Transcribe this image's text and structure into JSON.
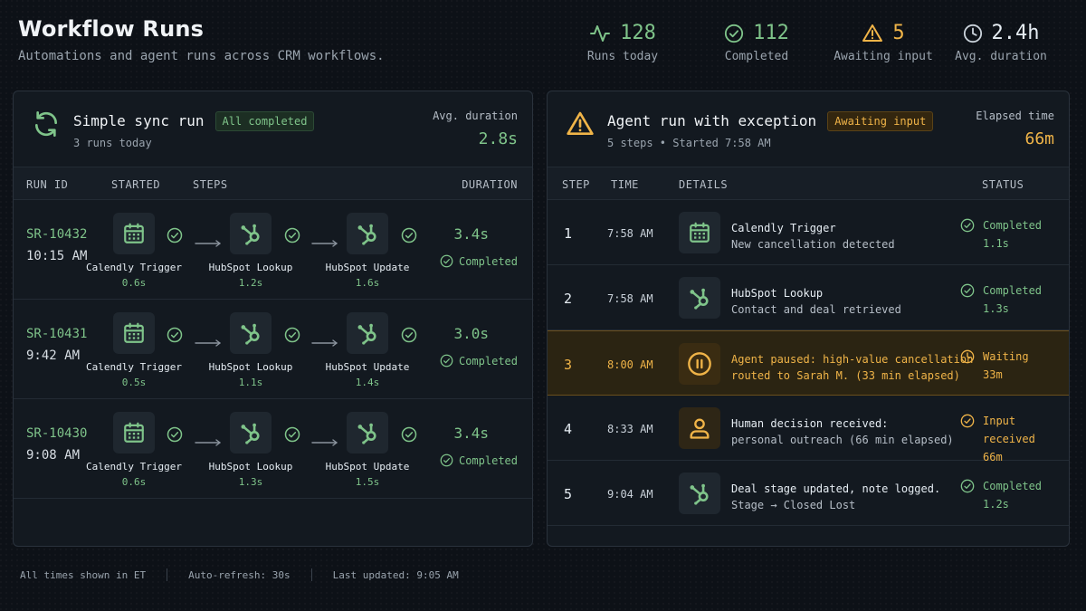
{
  "header": {
    "title": "Workflow Runs",
    "subtitle": "Automations and agent runs across CRM workflows."
  },
  "stats": [
    {
      "value": "128",
      "label": "Runs today",
      "icon": "activity-icon",
      "color": "#7fc48a"
    },
    {
      "value": "112",
      "label": "Completed",
      "icon": "check-circle-icon",
      "color": "#7fc48a"
    },
    {
      "value": "5",
      "label": "Awaiting input",
      "icon": "warning-icon",
      "color": "#f0b448"
    },
    {
      "value": "2.4h",
      "label": "Avg. duration",
      "icon": "clock-icon",
      "color": "#e6edf3"
    }
  ],
  "left_panel": {
    "title": "Simple sync run",
    "badge": "All completed",
    "subtitle": "3 runs today",
    "metric_label": "Avg. duration",
    "metric_value": "2.8s",
    "columns": [
      "RUN ID",
      "STARTED",
      "STEPS",
      "DURATION"
    ],
    "runs": [
      {
        "id": "SR-10432",
        "time": "10:15 AM",
        "duration": "3.4s",
        "status": "Completed",
        "steps": [
          {
            "name": "Calendly Trigger",
            "dur": "0.6s"
          },
          {
            "name": "HubSpot Lookup",
            "dur": "1.2s"
          },
          {
            "name": "HubSpot Update",
            "dur": "1.6s"
          }
        ]
      },
      {
        "id": "SR-10431",
        "time": "9:42 AM",
        "duration": "3.0s",
        "status": "Completed",
        "steps": [
          {
            "name": "Calendly Trigger",
            "dur": "0.5s"
          },
          {
            "name": "HubSpot Lookup",
            "dur": "1.1s"
          },
          {
            "name": "HubSpot Update",
            "dur": "1.4s"
          }
        ]
      },
      {
        "id": "SR-10430",
        "time": "9:08 AM",
        "duration": "3.4s",
        "status": "Completed",
        "steps": [
          {
            "name": "Calendly Trigger",
            "dur": "0.6s"
          },
          {
            "name": "HubSpot Lookup",
            "dur": "1.3s"
          },
          {
            "name": "HubSpot Update",
            "dur": "1.5s"
          }
        ]
      }
    ]
  },
  "right_panel": {
    "title": "Agent run with exception",
    "badge": "Awaiting input",
    "subtitle": "5 steps • Started 7:58 AM",
    "metric_label": "Elapsed time",
    "metric_value": "66m",
    "columns": [
      "STEP",
      "TIME",
      "DETAILS",
      "STATUS"
    ],
    "steps": [
      {
        "num": "1",
        "time": "7:58 AM",
        "icon": "calendar-icon",
        "d1": "Calendly Trigger",
        "d2": "New cancellation detected",
        "status": "Completed",
        "sub": "1.1s"
      },
      {
        "num": "2",
        "time": "7:58 AM",
        "icon": "hubspot-icon",
        "d1": "HubSpot Lookup",
        "d2": "Contact and deal retrieved",
        "status": "Completed",
        "sub": "1.3s"
      },
      {
        "num": "3",
        "time": "8:00 AM",
        "icon": "pause-icon",
        "d1": "Agent paused: high-value cancellation",
        "d2": "routed to Sarah M. (33 min elapsed)",
        "status": "Waiting",
        "sub": "33m"
      },
      {
        "num": "4",
        "time": "8:33 AM",
        "icon": "person-icon",
        "d1": "Human decision received:",
        "d2": "personal outreach (66 min elapsed)",
        "status": "Input received",
        "sub": "66m"
      },
      {
        "num": "5",
        "time": "9:04 AM",
        "icon": "hubspot-icon",
        "d1": "Deal stage updated, note logged.",
        "d2": "Stage → Closed Lost",
        "status": "Completed",
        "sub": "1.2s"
      }
    ]
  },
  "footer": {
    "timezone": "All times shown in ET",
    "refresh": "Auto-refresh: 30s",
    "updated": "Last updated: 9:05 AM"
  }
}
